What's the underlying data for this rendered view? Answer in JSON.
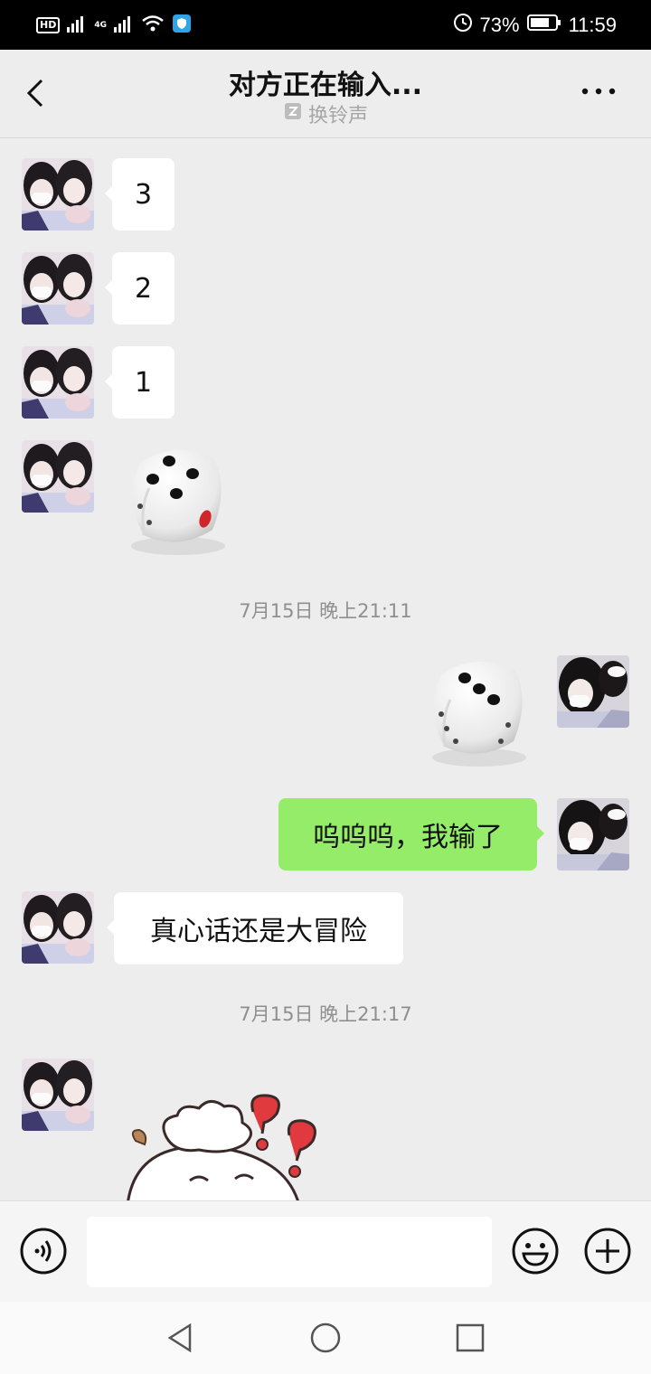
{
  "status_bar": {
    "network": "4G",
    "battery": "73%",
    "time": "11:59",
    "icons": [
      "hd-icon",
      "signal-icon",
      "wifi-icon",
      "shield-icon",
      "data-saver-icon",
      "battery-icon"
    ]
  },
  "header": {
    "title": "对方正在输入...",
    "subtitle": "换铃声"
  },
  "messages": [
    {
      "side": "left",
      "type": "text",
      "text": "3"
    },
    {
      "side": "left",
      "type": "text",
      "text": "2"
    },
    {
      "side": "left",
      "type": "text",
      "text": "1"
    },
    {
      "side": "left",
      "type": "dice",
      "value": 5
    },
    {
      "type": "timestamp",
      "text": "7月15日 晚上21:11"
    },
    {
      "side": "right",
      "type": "dice",
      "value": 3
    },
    {
      "side": "right",
      "type": "text",
      "text": "呜呜呜，我输了"
    },
    {
      "side": "left",
      "type": "text",
      "text": "真心话还是大冒险"
    },
    {
      "type": "timestamp",
      "text": "7月15日 晚上21:17"
    },
    {
      "side": "left",
      "type": "sticker",
      "name": "confused-sheep-sticker"
    }
  ],
  "colors": {
    "background": "#ededed",
    "sent_bubble": "#95ec69",
    "received_bubble": "#ffffff",
    "timestamp": "#8f8f8f"
  }
}
